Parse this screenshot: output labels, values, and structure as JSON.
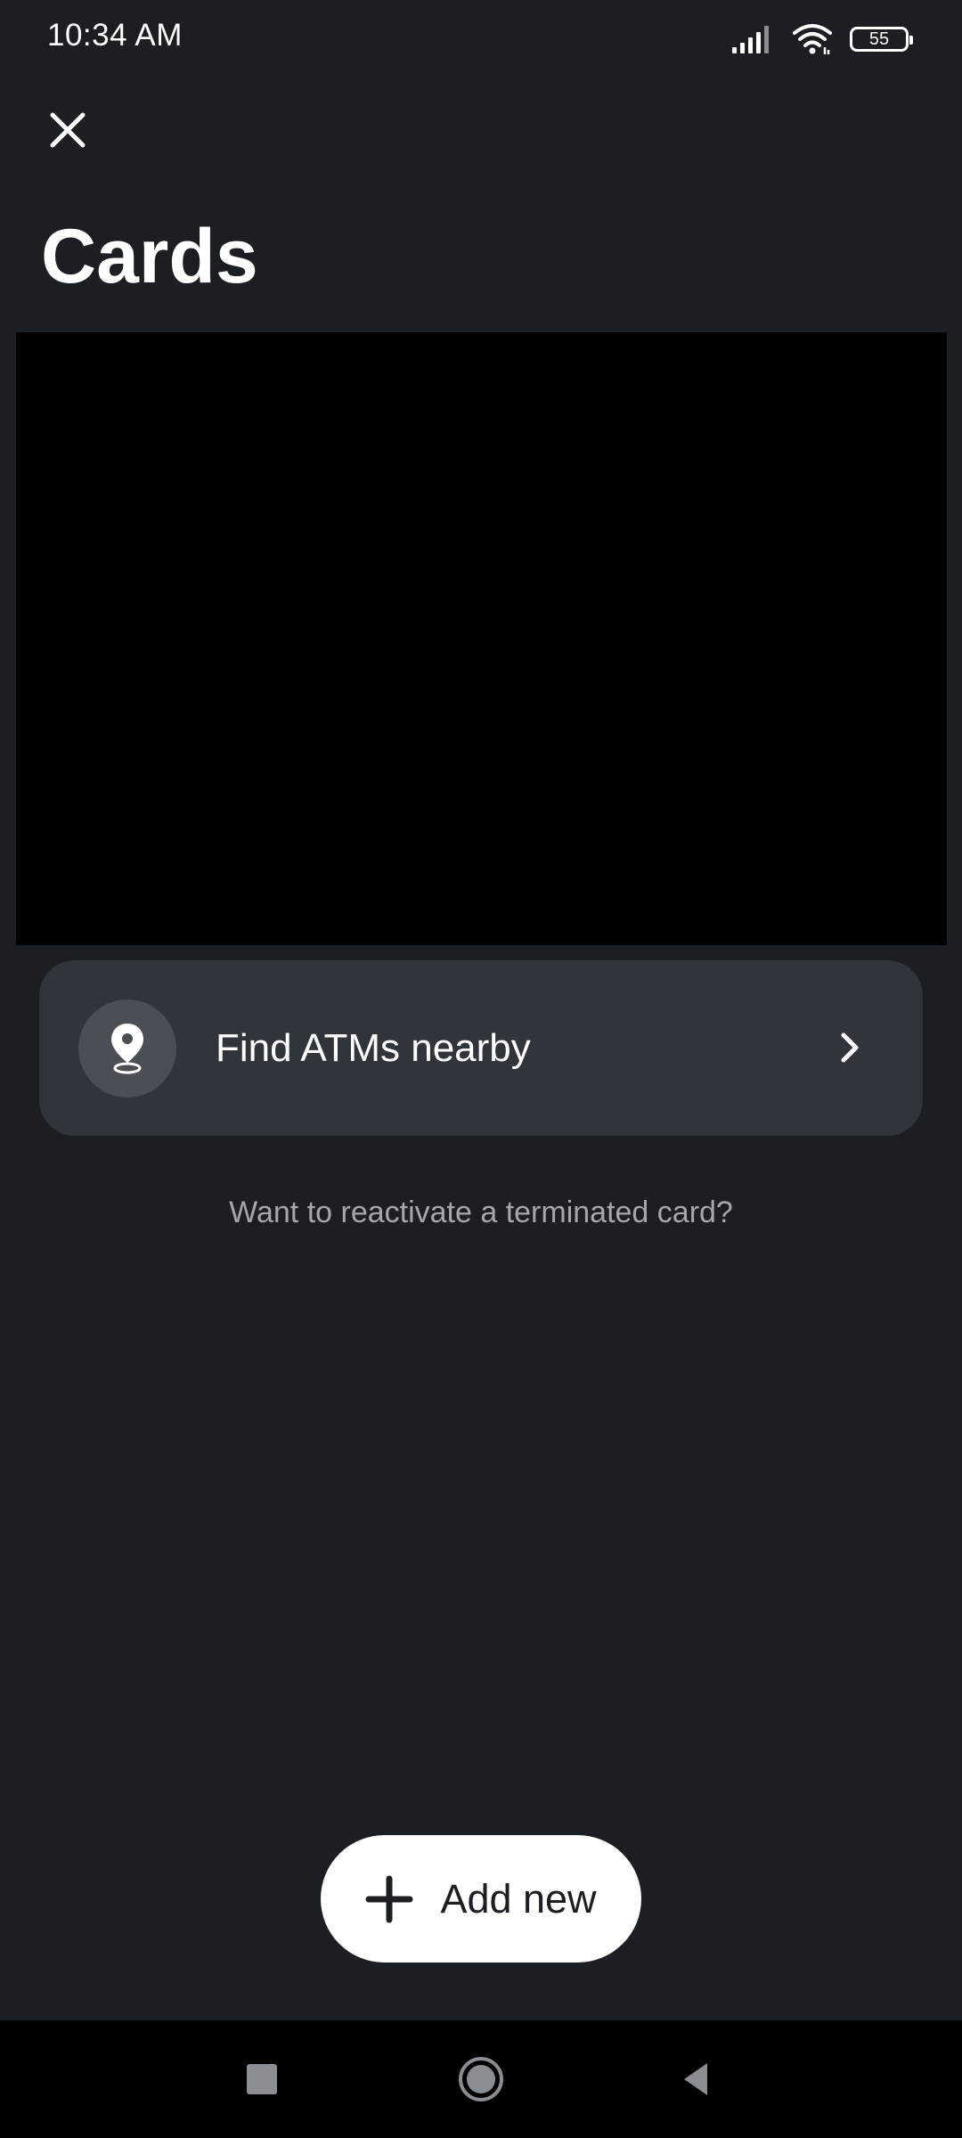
{
  "status_bar": {
    "time": "10:34 AM",
    "battery_level": "55",
    "icons": [
      "signal-icon",
      "wifi-icon",
      "battery-icon"
    ]
  },
  "header": {
    "close_icon": "close-icon",
    "title": "Cards"
  },
  "atm": {
    "icon": "location-pin-icon",
    "label": "Find ATMs nearby",
    "chevron_icon": "chevron-right-icon"
  },
  "reactivate": {
    "text": "Want to reactivate a terminated card?"
  },
  "add_new": {
    "icon": "plus-icon",
    "label": "Add new"
  },
  "nav_bar": {
    "items": [
      "recents-icon",
      "home-icon",
      "back-icon"
    ]
  },
  "colors": {
    "background": "#1b1e22",
    "row_background": "#30353b",
    "icon_circle": "#4a4f55",
    "muted_text": "#a4a8ad",
    "button_background": "#ffffff"
  }
}
